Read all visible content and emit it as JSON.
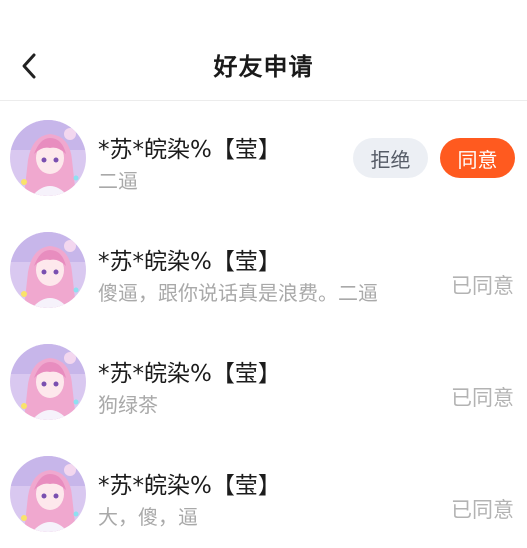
{
  "header": {
    "back_icon": "chevron-left-icon",
    "title": "好友申请"
  },
  "requests": [
    {
      "name": "*苏*皖染%【莹】",
      "message": "二逼",
      "state": "pending",
      "reject_label": "拒绝",
      "accept_label": "同意"
    },
    {
      "name": "*苏*皖染%【莹】",
      "message": "傻逼，跟你说话真是浪费。二逼",
      "state": "accepted",
      "status_label": "已同意"
    },
    {
      "name": "*苏*皖染%【莹】",
      "message": "狗绿茶",
      "state": "accepted",
      "status_label": "已同意"
    },
    {
      "name": "*苏*皖染%【莹】",
      "message": "大，傻，逼",
      "state": "accepted",
      "status_label": "已同意"
    }
  ],
  "colors": {
    "accent": "#ff5a1f",
    "reject_bg": "#eceff4",
    "muted_text": "#a9a9a9",
    "divider": "#ececec"
  }
}
